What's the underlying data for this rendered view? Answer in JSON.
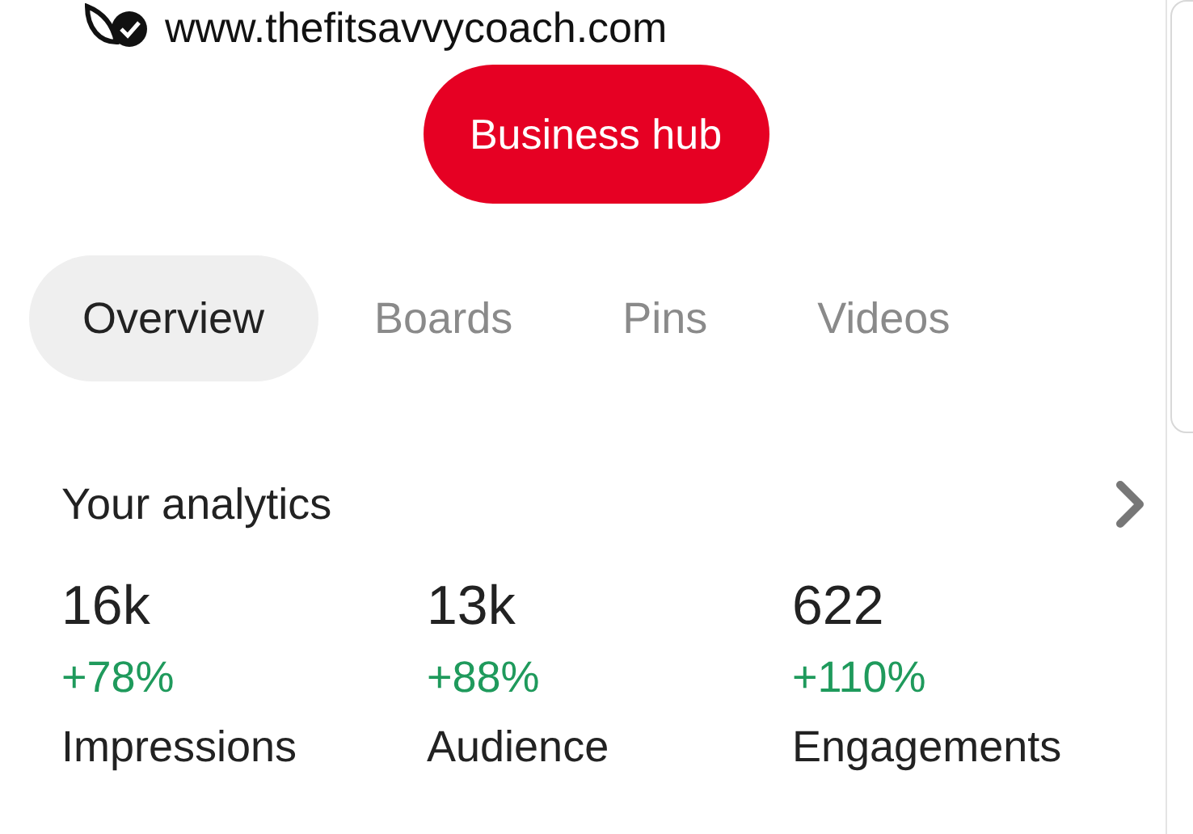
{
  "profile": {
    "website": "www.thefitsavvycoach.com",
    "verified": true
  },
  "business_hub_button": "Business hub",
  "tabs": [
    {
      "label": "Overview",
      "selected": true
    },
    {
      "label": "Boards",
      "selected": false
    },
    {
      "label": "Pins",
      "selected": false
    },
    {
      "label": "Videos",
      "selected": false
    }
  ],
  "analytics": {
    "title": "Your analytics",
    "metrics": [
      {
        "value": "16k",
        "change": "+78%",
        "label": "Impressions"
      },
      {
        "value": "13k",
        "change": "+88%",
        "label": "Audience"
      },
      {
        "value": "622",
        "change": "+110%",
        "label": "Engagements"
      }
    ]
  }
}
